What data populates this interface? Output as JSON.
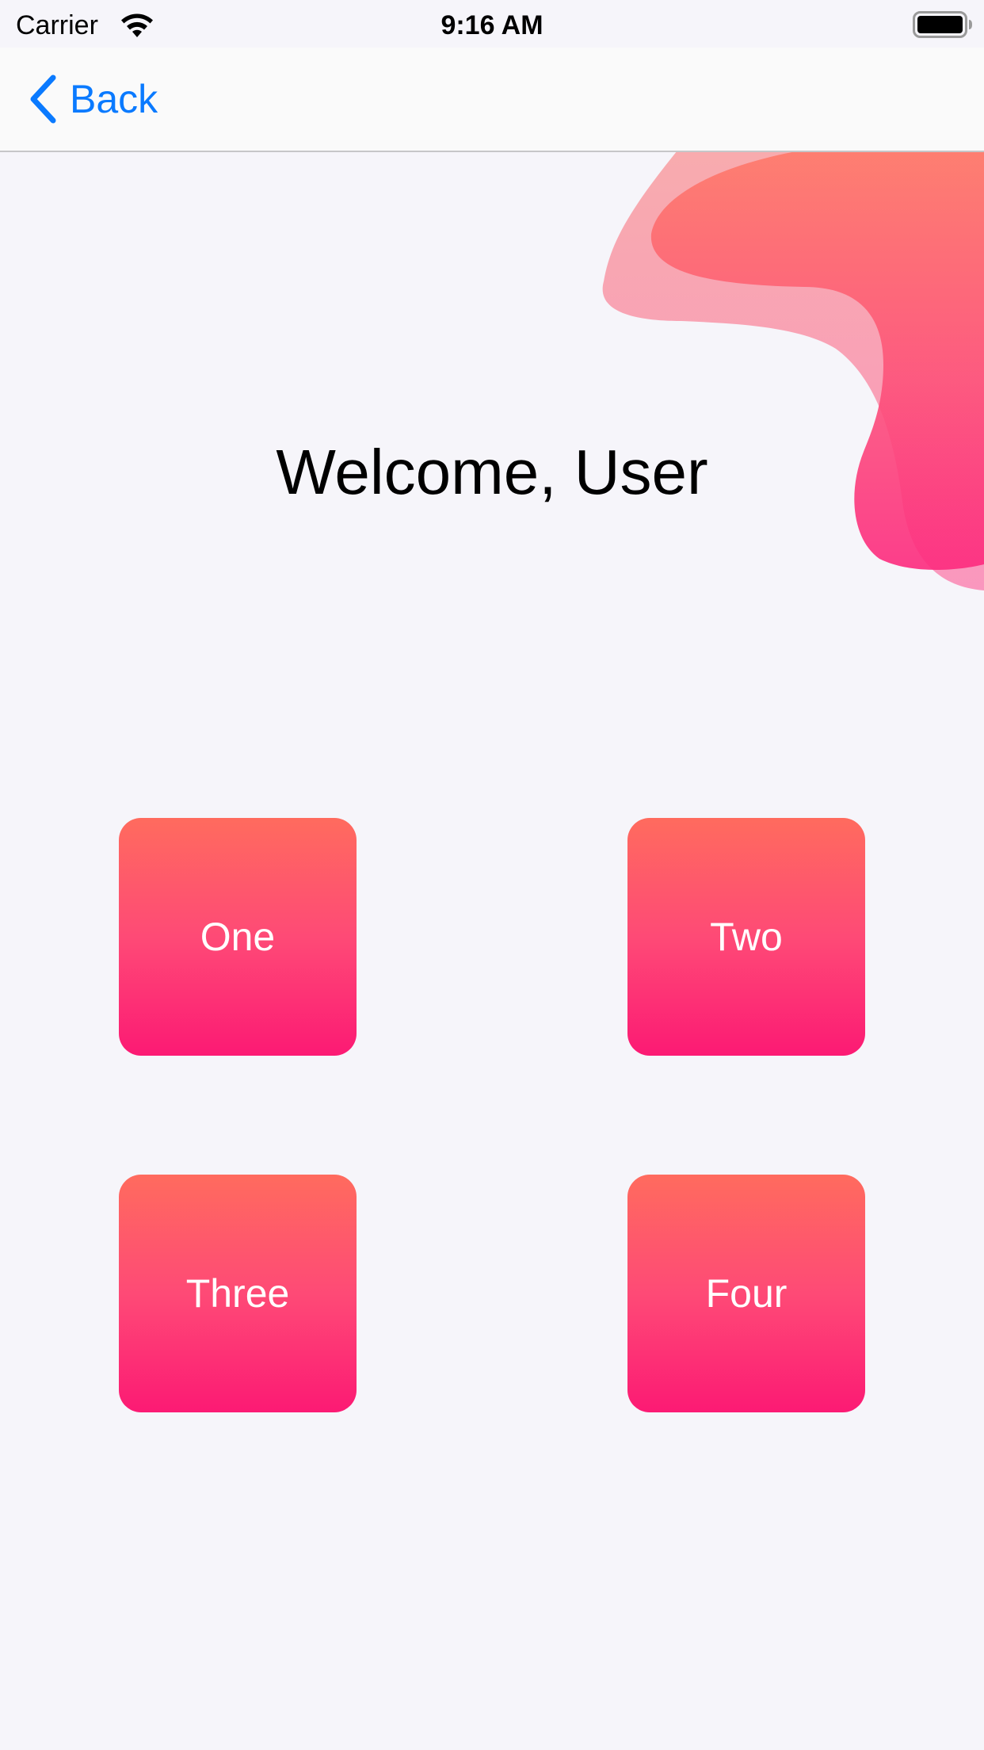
{
  "status_bar": {
    "carrier": "Carrier",
    "time": "9:16 AM",
    "wifi_icon": "wifi-icon",
    "battery_icon": "battery-icon"
  },
  "nav_bar": {
    "back_label": "Back",
    "back_icon": "chevron-left-icon"
  },
  "main": {
    "title": "Welcome, User",
    "tiles": [
      {
        "label": "One"
      },
      {
        "label": "Two"
      },
      {
        "label": "Three"
      },
      {
        "label": "Four"
      }
    ]
  },
  "colors": {
    "accent": "#0a7aff",
    "background": "#f6f5fa",
    "tile_gradient_top": "#ff6b5e",
    "tile_gradient_bottom": "#fc1a74",
    "blob_light": "#f99aa6",
    "blob_dark": "#fe5a82"
  }
}
